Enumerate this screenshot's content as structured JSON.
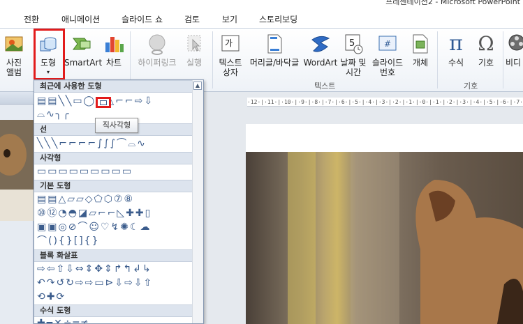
{
  "window": {
    "title": "프레젠테이션2 - Microsoft PowerPoint"
  },
  "tabs": [
    "전환",
    "애니메이션",
    "슬라이드 쇼",
    "검토",
    "보기",
    "스토리보딩"
  ],
  "ribbon": {
    "photo_album": {
      "line1": "사진",
      "line2": "앨범"
    },
    "shapes": {
      "label": "도형"
    },
    "smartart": {
      "label": "SmartArt"
    },
    "chart": {
      "label": "차트"
    },
    "hyperlink": {
      "label": "하이퍼링크"
    },
    "action": {
      "label": "실행"
    },
    "textbox": {
      "line1": "텍스트",
      "line2": "상자"
    },
    "header_footer": {
      "label": "머리글/바닥글"
    },
    "wordart": {
      "label": "WordArt"
    },
    "datetime": {
      "line1": "날짜 및",
      "line2": "시간"
    },
    "slide_number": {
      "line1": "슬라이드",
      "line2": "번호"
    },
    "object": {
      "label": "개체"
    },
    "equation": {
      "label": "수식"
    },
    "symbol": {
      "label": "기호"
    },
    "video": {
      "label": "비디"
    },
    "groups": {
      "text": "텍스트",
      "symbols": "기호"
    }
  },
  "dropdown": {
    "sections": [
      "최근에 사용한 도형",
      "선",
      "사각형",
      "기본 도형",
      "블록 화살표",
      "수식 도형"
    ],
    "rows": {
      "recent1": "▤▤╲╲▭◯▭△⌐⌐⇨⇩",
      "recent2": "⌓∿╮╭",
      "lines": "╲╲╲⌐⌐⌐⌐∫∫∫⌒⌓∿",
      "rects": "▭▭▭▭▭▭▭▭▭",
      "basic1": "▤▤△▱▱◇⬠⬡⑦⑧",
      "basic2": "⑩⑫◔◓◪▱⌐⌐◺✚✚▯",
      "basic3": "▣▣◎⊘⌒☺♡↯✺☾☁",
      "basic4": "⌒(){}[]{}",
      "arrows1": "⇨⇦⇧⇩⇔⇕✥⇕↱↰↲↳",
      "arrows2": "↶↷↺↻⇨⇨▭⊳⇩⇨⇩⇧",
      "arrows3": "⟲✚⟳",
      "eq1": "✚━✕÷═≠"
    },
    "tooltip": "직사각형"
  },
  "ruler": {
    "text": "·12·|·11·|·10·|·9·|·8·|·7·|·6·|·5·|·4·|·3·|·2·|·1·|·0·|·1·|·2·|·3·|·4·|·5·|·6·|·7·|·8·"
  },
  "colors": {
    "highlight": "#e21b1b",
    "shape_stroke": "#3b5c8c"
  }
}
